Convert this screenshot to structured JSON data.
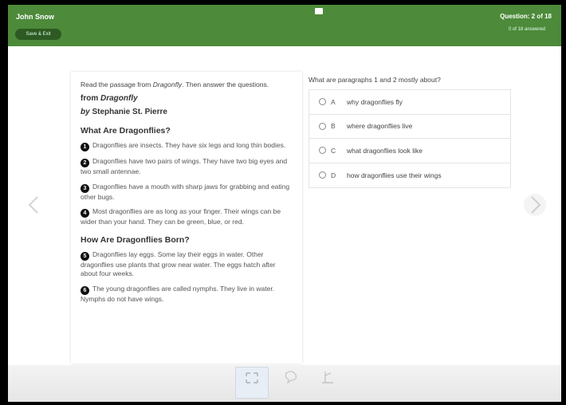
{
  "header": {
    "user_name": "John Snow",
    "save_exit_label": "Save & Exit",
    "question_counter": "Question: 2 of 18",
    "answered_status": "0 of 18 answered"
  },
  "passage": {
    "instruction_prefix": "Read the passage from ",
    "instruction_title": "Dragonfly",
    "instruction_suffix": ". Then answer the questions.",
    "title_prefix": "from ",
    "title": "Dragonfly",
    "author_prefix": "by ",
    "author": "Stephanie St. Pierre",
    "sections": [
      {
        "heading": "What Are Dragonflies?",
        "paragraphs": [
          {
            "num": "1",
            "text": "Dragonflies are insects. They have six legs and long thin bodies."
          },
          {
            "num": "2",
            "text": "Dragonflies have two pairs of wings. They have two big eyes and two small antennae."
          },
          {
            "num": "3",
            "text": "Dragonflies have a mouth with sharp jaws for grabbing and eating other bugs."
          },
          {
            "num": "4",
            "text": "Most dragonflies are as long as your finger. Their wings can be wider than your hand. They can be green, blue, or red."
          }
        ]
      },
      {
        "heading": "How Are Dragonflies Born?",
        "paragraphs": [
          {
            "num": "5",
            "text": "Dragonflies lay eggs. Some lay their eggs in water. Other dragonflies use plants that grow near water. The eggs hatch after about four weeks."
          },
          {
            "num": "6",
            "text": "The young dragonflies are called nymphs. They live in water. Nymphs do not have wings."
          }
        ]
      }
    ]
  },
  "question": {
    "text": "What are paragraphs 1 and 2 mostly about?",
    "options": [
      {
        "letter": "A",
        "text": "why dragonflies fly"
      },
      {
        "letter": "B",
        "text": "where dragonflies live"
      },
      {
        "letter": "C",
        "text": "what dragonflies look like"
      },
      {
        "letter": "D",
        "text": "how dragonflies use their wings"
      }
    ]
  },
  "icons": {
    "prev": "chevron-left-icon",
    "next": "chevron-right-icon",
    "tools": [
      "expand-icon",
      "speech-icon",
      "highlighter-icon"
    ]
  },
  "colors": {
    "header_green": "#4d8a3a",
    "button_dark_green": "#2d5a22"
  }
}
